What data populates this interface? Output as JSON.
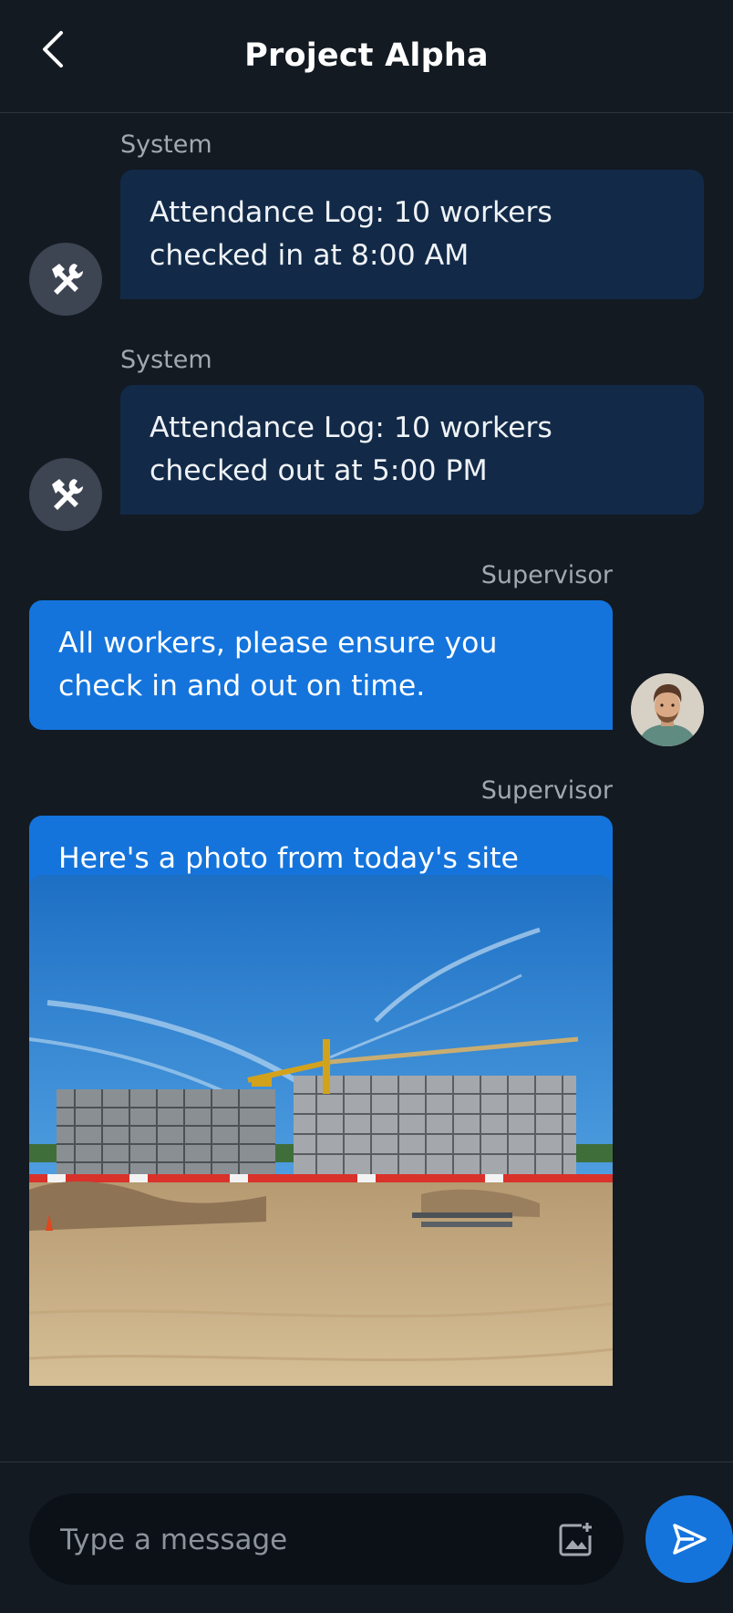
{
  "header": {
    "title": "Project Alpha",
    "back_icon": "chevron-left-icon"
  },
  "messages": [
    {
      "sender": "System",
      "text": "Attendance Log: 10 workers checked in at 8:00 AM",
      "avatar_icon": "tools-icon",
      "side": "left"
    },
    {
      "sender": "System",
      "text": "Attendance Log: 10 workers checked out at 5:00 PM",
      "avatar_icon": "tools-icon",
      "side": "left"
    },
    {
      "sender": "Supervisor",
      "text": "All workers, please ensure you check in and out on time.",
      "avatar": "supervisor-avatar",
      "side": "right"
    },
    {
      "sender": "Supervisor",
      "text": "Here's a photo from today's site inspection.",
      "attachment": "construction-site-photo",
      "side": "right"
    }
  ],
  "composer": {
    "placeholder": "Type a message",
    "attach_icon": "add-photo-icon",
    "send_icon": "send-icon"
  },
  "colors": {
    "background": "#131a22",
    "system_bubble": "#122a48",
    "user_bubble": "#1474dc",
    "accent": "#1474dc",
    "muted_text": "#a3a8b0"
  }
}
